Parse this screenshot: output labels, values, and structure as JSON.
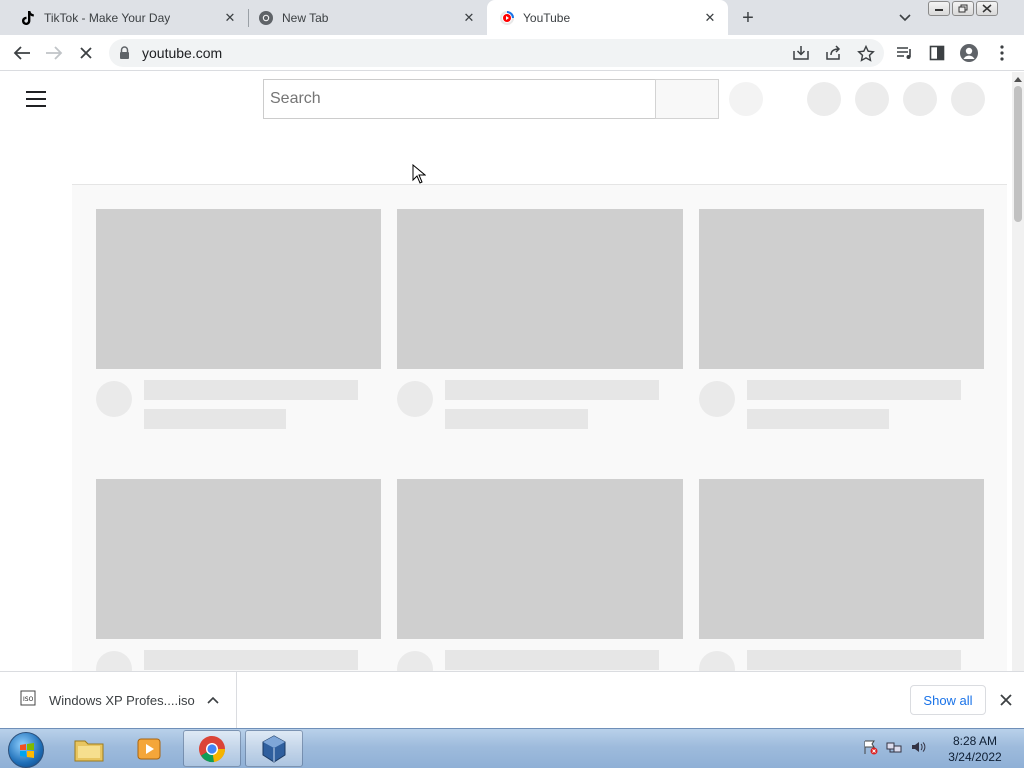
{
  "browser": {
    "tabs": [
      {
        "title": "TikTok - Make Your Day",
        "icon": "tiktok-icon",
        "active": false
      },
      {
        "title": "New Tab",
        "icon": "chrome-icon",
        "active": false
      },
      {
        "title": "YouTube",
        "icon": "youtube-loading-icon",
        "active": true
      }
    ],
    "new_tab_label": "+",
    "address": "youtube.com"
  },
  "youtube": {
    "search_placeholder": "Search"
  },
  "downloads": {
    "file_name": "Windows XP Profes....iso",
    "show_all_label": "Show all"
  },
  "taskbar": {
    "time": "8:28 AM",
    "date": "3/24/2022"
  },
  "colors": {
    "tabstrip": "#dee1e6",
    "accent_blue": "#1a73e8",
    "placeholder_gray": "#cfcfcf"
  }
}
